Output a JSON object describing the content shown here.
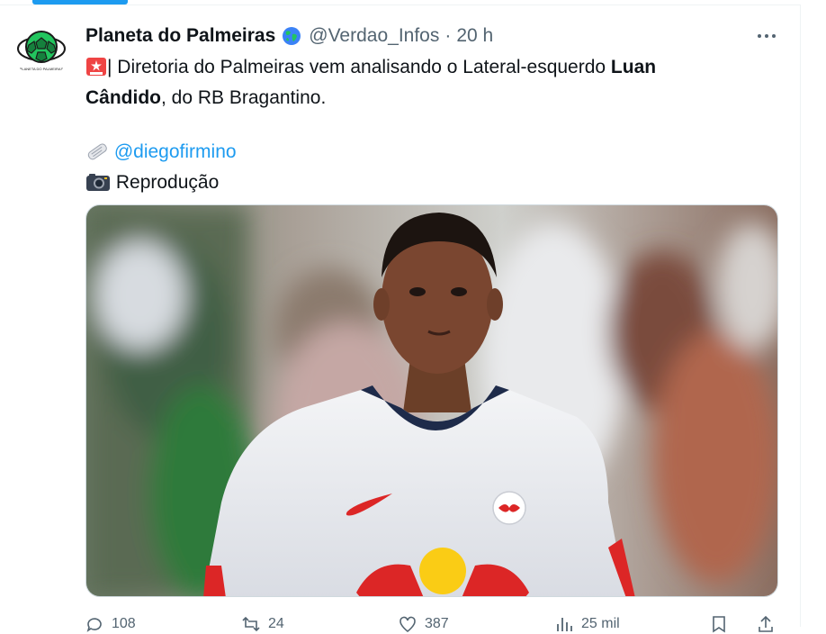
{
  "tweet": {
    "author_name": "Planeta do Palmeiras",
    "handle": "@Verdao_Infos",
    "separator": "·",
    "time": "20 h",
    "line1_prefix": "| Diretoria do Palmeiras vem analisando o Lateral-esquerdo ",
    "line1_bold": "Luan",
    "line2_bold": "Cândido",
    "line2_suffix": ", do RB Bragantino.",
    "mention": "@diegofirmino",
    "credit": "Reprodução",
    "avatar_logo_text": "PLANETA DO PALMEIRAS"
  },
  "actions": {
    "replies": "108",
    "retweets": "24",
    "likes": "387",
    "views": "25 mil"
  },
  "colors": {
    "accent": "#1d9bf0",
    "muted": "#536471",
    "palmeiras_green": "#16a34a"
  },
  "icons": [
    "siren-icon",
    "newspaper-icon",
    "camera-icon",
    "globe-icon",
    "more-icon",
    "reply-icon",
    "retweet-icon",
    "like-icon",
    "views-icon",
    "bookmark-icon",
    "share-icon"
  ]
}
